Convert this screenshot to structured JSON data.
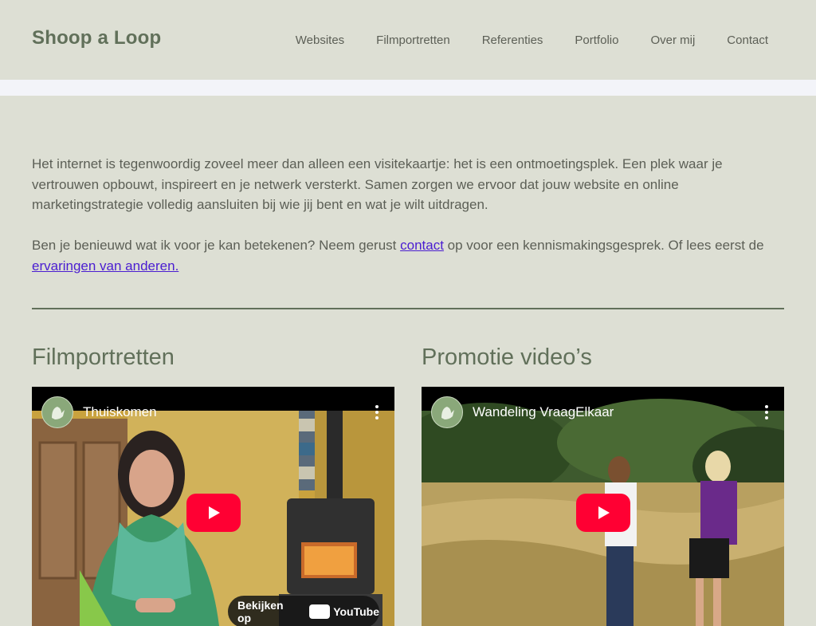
{
  "header": {
    "brand": "Shoop a Loop",
    "nav": [
      "Websites",
      "Filmportretten",
      "Referenties",
      "Portfolio",
      "Over mij",
      "Contact"
    ]
  },
  "intro": {
    "p1": "Het internet is tegenwoordig zoveel meer dan alleen een visitekaartje: het is een ontmoetingsplek. Een plek waar je vertrouwen opbouwt, inspireert en je netwerk versterkt. Samen zorgen we ervoor dat jouw website en online marketingstrategie volledig aansluiten bij wie jij bent en wat je wilt uitdragen.",
    "p2_before": "Ben je benieuwd wat ik voor je kan betekenen? Neem gerust ",
    "p2_link1": "contact",
    "p2_middle": " op voor een kennismakingsgesprek. Of lees eerst de ",
    "p2_link2": "ervaringen van anderen."
  },
  "sections": [
    {
      "heading": "Filmportretten",
      "video": {
        "title": "Thuiskomen",
        "watch_partial": "Bekijken op",
        "yt_partial": "YouTube"
      }
    },
    {
      "heading": "Promotie video’s",
      "video": {
        "title": "Wandeling VraagElkaar"
      }
    }
  ],
  "colors": {
    "background": "#dddfd4",
    "brand": "#61705a",
    "text": "#5c5f56",
    "link": "#4a1dd1",
    "play": "#ff0033"
  },
  "icons": [
    "channel-logo-icon",
    "more-options-icon",
    "play-icon",
    "youtube-logo-icon"
  ]
}
